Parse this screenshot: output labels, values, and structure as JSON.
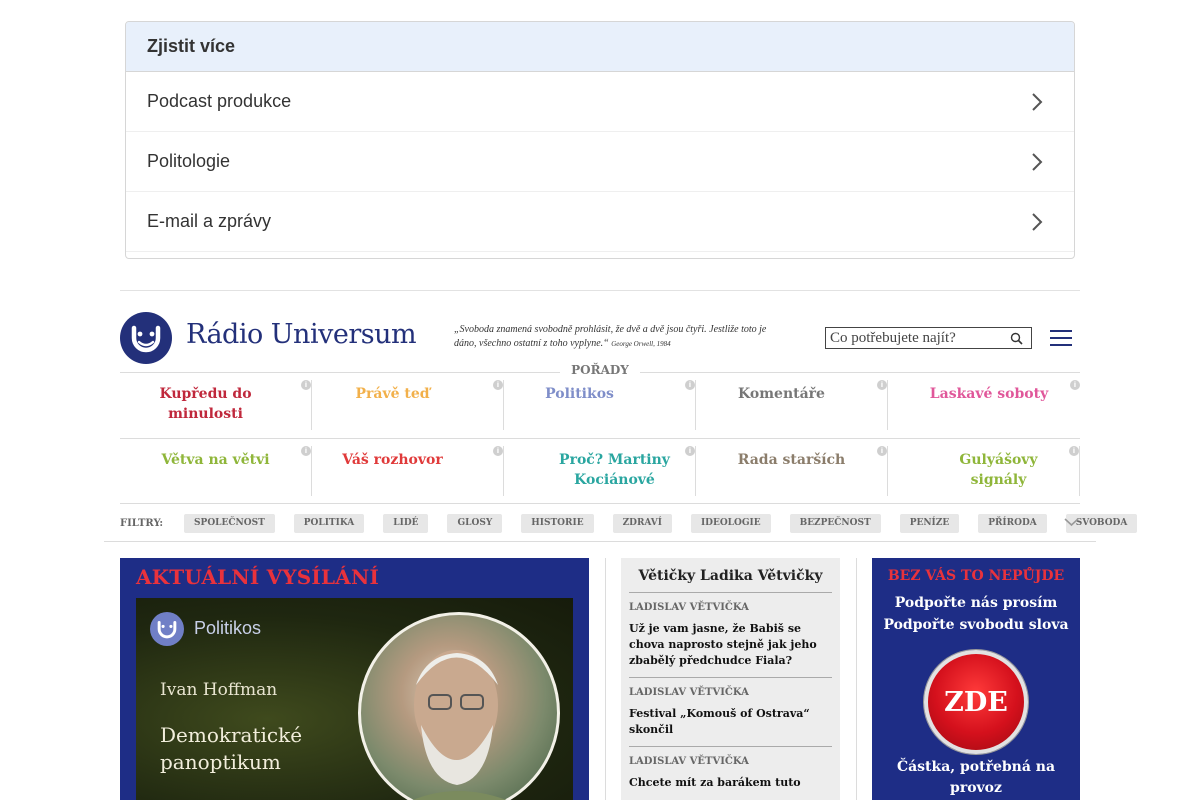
{
  "accordion": {
    "title": "Zjistit více",
    "items": [
      {
        "label": "Podcast produkce"
      },
      {
        "label": "Politologie"
      },
      {
        "label": "E-mail a zprávy"
      }
    ]
  },
  "header": {
    "logo_text": "Rádio Universum",
    "quote": "„Svoboda znamená svobodně prohlásit, že dvě a dvě jsou čtyři. Jestliže toto je dáno, všechno ostatní z toho vyplyne.“",
    "quote_author": "George Orwell, 1984",
    "search_placeholder": "Co potřebujete najít?"
  },
  "programmes": {
    "heading": "POŘADY",
    "row1": [
      {
        "label": "Kupředu do minulosti",
        "color": "#c0283c"
      },
      {
        "label": "Právě teď",
        "color": "#f2b04a"
      },
      {
        "label": "Politikos",
        "color": "#7f8ec9"
      },
      {
        "label": "Komentáře",
        "color": "#777777"
      },
      {
        "label": "Laskavé soboty",
        "color": "#e0579a"
      }
    ],
    "row2": [
      {
        "label": "Větva na větvi",
        "color": "#8fb63a"
      },
      {
        "label": "Váš rozhovor",
        "color": "#e03a3a"
      },
      {
        "label": "Proč? Martiny Kociánové",
        "color": "#2aa6a0"
      },
      {
        "label": "Rada starších",
        "color": "#8b7d6b"
      },
      {
        "label": "Gulyášovy signály",
        "color": "#8fb63a"
      }
    ],
    "info_glyph": "i"
  },
  "filters": {
    "label": "FILTRY:",
    "chips": [
      "SPOLEČNOST",
      "POLITIKA",
      "LIDÉ",
      "GLOSY",
      "HISTORIE",
      "ZDRAVÍ",
      "IDEOLOGIE",
      "BEZPEČNOST",
      "PENÍZE",
      "PŘÍRODA",
      "SVOBODA"
    ]
  },
  "live": {
    "heading": "AKTUÁLNÍ VYSÍLÁNÍ",
    "show": "Politikos",
    "author": "Ivan Hoffman",
    "title": "Demokratické panoptikum"
  },
  "column": {
    "heading": "Větičky Ladika Větvičky",
    "articles": [
      {
        "author": "LADISLAV VĚTVIČKA",
        "title": "Už je vam jasne, že Babiš se chova naprosto stejně jak jeho zbabělý předchudce Fiala?"
      },
      {
        "author": "LADISLAV VĚTVIČKA",
        "title": "Festival „Komouš of Ostrava“ skončil"
      },
      {
        "author": "LADISLAV VĚTVIČKA",
        "title": "Chcete mít za barákem tuto"
      }
    ]
  },
  "support": {
    "heading": "BEZ VÁS TO NEPŮJDE",
    "line1": "Podpořte nás prosím",
    "line2": "Podpořte svobodu slova",
    "button": "ZDE",
    "footer": "Částka, potřebná na provoz"
  },
  "colors": {
    "brand_blue": "#23307a",
    "box_blue": "#1e2d86",
    "accent_red": "#e9323c"
  }
}
